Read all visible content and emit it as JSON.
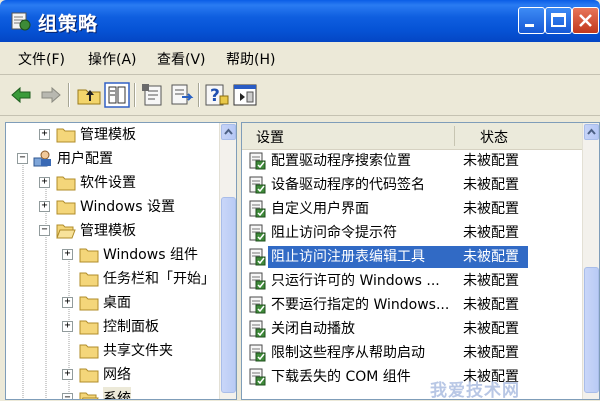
{
  "window": {
    "title": "组策略"
  },
  "menu": [
    {
      "label": "文件(F)"
    },
    {
      "label": "操作(A)"
    },
    {
      "label": "查看(V)"
    },
    {
      "label": "帮助(H)"
    }
  ],
  "tree": [
    {
      "label": "管理模板",
      "expander": "+"
    },
    {
      "label": "用户配置",
      "expander": "−"
    },
    {
      "label": "软件设置",
      "expander": "+"
    },
    {
      "label": "Windows 设置",
      "expander": "+"
    },
    {
      "label": "管理模板",
      "expander": "−"
    },
    {
      "label": "Windows 组件",
      "expander": "+"
    },
    {
      "label": "任务栏和「开始」",
      "expander": ""
    },
    {
      "label": "桌面",
      "expander": "+"
    },
    {
      "label": "控制面板",
      "expander": "+"
    },
    {
      "label": "共享文件夹",
      "expander": ""
    },
    {
      "label": "网络",
      "expander": "+"
    },
    {
      "label": "系统",
      "expander": "−"
    }
  ],
  "list": {
    "columns": {
      "setting": "设置",
      "state": "状态"
    },
    "rows": [
      {
        "name": "配置驱动程序搜索位置",
        "state": "未被配置"
      },
      {
        "name": "设备驱动程序的代码签名",
        "state": "未被配置"
      },
      {
        "name": "自定义用户界面",
        "state": "未被配置"
      },
      {
        "name": "阻止访问命令提示符",
        "state": "未被配置"
      },
      {
        "name": "阻止访问注册表编辑工具",
        "state": "未被配置"
      },
      {
        "name": "只运行许可的 Windows ...",
        "state": "未被配置"
      },
      {
        "name": "不要运行指定的 Windows...",
        "state": "未被配置"
      },
      {
        "name": "关闭自动播放",
        "state": "未被配置"
      },
      {
        "name": "限制这些程序从帮助启动",
        "state": "未被配置"
      },
      {
        "name": "下载丢失的 COM 组件",
        "state": "未被配置"
      }
    ],
    "selected_index": 4
  },
  "watermark": "我爱技术网",
  "colors": {
    "title_bar": "#0653d6",
    "selection": "#316ac5",
    "window_bg": "#ece9d8"
  },
  "icons": [
    "policy-app-icon",
    "back-arrow-icon",
    "forward-arrow-icon",
    "up-folder-icon",
    "show-hide-tree-icon",
    "properties-icon",
    "export-list-icon",
    "help-icon",
    "policy-setting-icon"
  ]
}
